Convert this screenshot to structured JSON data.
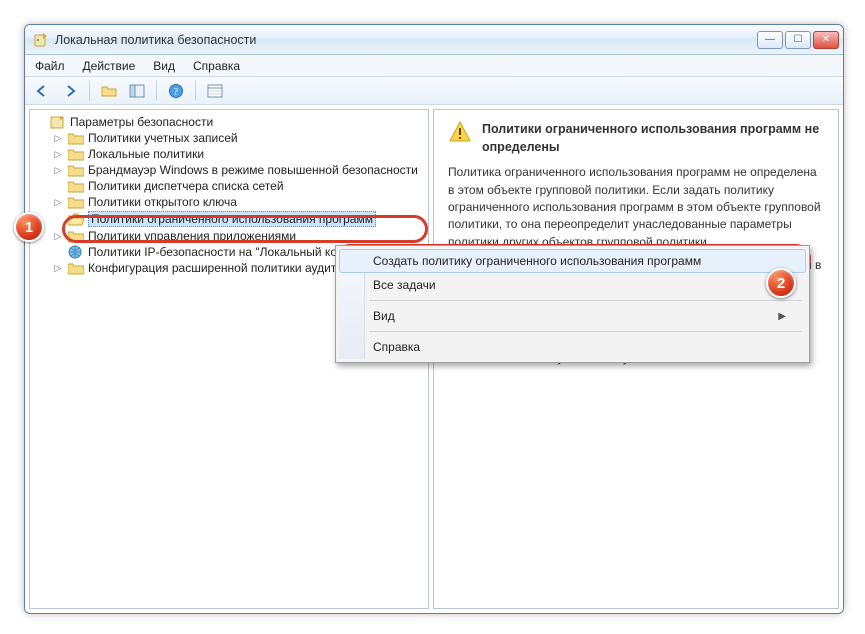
{
  "window": {
    "title": "Локальная политика безопасности"
  },
  "menu": {
    "file": "Файл",
    "action": "Действие",
    "view": "Вид",
    "help": "Справка"
  },
  "tree": {
    "root": "Параметры безопасности",
    "n0": "Политики учетных записей",
    "n1": "Локальные политики",
    "n2": "Брандмауэр Windows в режиме повышенной безопасности",
    "n3": "Политики диспетчера списка сетей",
    "n4": "Политики открытого ключа",
    "n5": "Политики ограниченного использования программ",
    "n6": "Политики управления приложениями",
    "n7": "Политики IP-безопасности на \"Локальный компьютер\"",
    "n8": "Конфигурация расширенной политики аудита"
  },
  "detail": {
    "title": "Политики ограниченного использования программ не определены",
    "p1": "Политика ограниченного использования программ не определена в этом объекте групповой политики. Если задать политику ограниченного использования программ в этом объекте групповой политики, то она переопределит унаследованные параметры политики других объектов групповой политики.",
    "p2": "Для установки политики ограниченного использования программ в меню \"Действие\" выберите команду \"Создать политику ограниченного использования программ\".",
    "p3": "Примечание. После установки политики ограниченного использования программ необходимо перезагрузить компьютер, чтобы политика вступила в силу."
  },
  "ctx": {
    "create": "Создать политику ограниченного использования программ",
    "all_tasks": "Все задачи",
    "view": "Вид",
    "help": "Справка"
  },
  "callout": {
    "one": "1",
    "two": "2"
  }
}
